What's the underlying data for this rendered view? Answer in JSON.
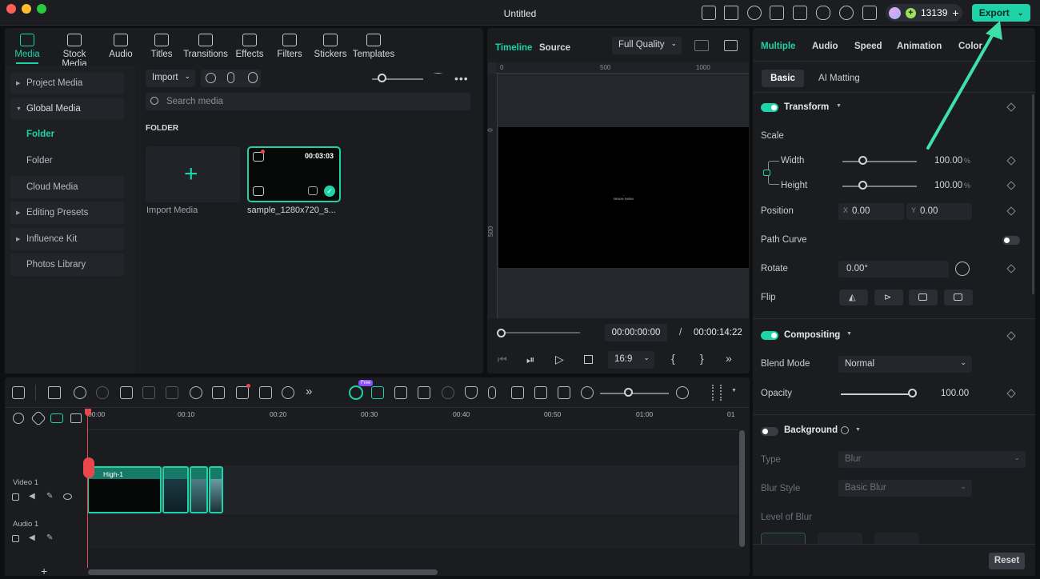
{
  "window": {
    "title": "Untitled"
  },
  "topbar": {
    "credits": "13139",
    "export_label": "Export"
  },
  "media_tabs": [
    {
      "label": "Media",
      "icon": "media-icon",
      "active": true
    },
    {
      "label": "Stock Media",
      "icon": "stock-media-icon"
    },
    {
      "label": "Audio",
      "icon": "audio-icon"
    },
    {
      "label": "Titles",
      "icon": "titles-icon"
    },
    {
      "label": "Transitions",
      "icon": "transitions-icon"
    },
    {
      "label": "Effects",
      "icon": "effects-icon"
    },
    {
      "label": "Filters",
      "icon": "filters-icon"
    },
    {
      "label": "Stickers",
      "icon": "stickers-icon"
    },
    {
      "label": "Templates",
      "icon": "templates-icon"
    }
  ],
  "sidebar": {
    "project_media": "Project Media",
    "global_media": "Global Media",
    "folder_active": "Folder",
    "folder": "Folder",
    "cloud_media": "Cloud Media",
    "editing_presets": "Editing Presets",
    "influence_kit": "Influence Kit",
    "photos_library": "Photos Library"
  },
  "media_panel": {
    "import_label": "Import",
    "search_placeholder": "Search media",
    "folder_heading": "FOLDER",
    "import_media_label": "Import Media",
    "clip_name": "sample_1280x720_s...",
    "clip_duration": "00:03:03"
  },
  "preview": {
    "tab_timeline": "Timeline",
    "tab_source": "Source",
    "quality": "Full Quality",
    "ruler": [
      "0",
      "500",
      "1000"
    ],
    "vruler": [
      "0",
      "500"
    ],
    "overlay_text_1": "...",
    "overlay_text_2": "BRAIN FARM",
    "current_time": "00:00:00:00",
    "separator": "/",
    "total_time": "00:00:14:22",
    "aspect": "16:9"
  },
  "props": {
    "tabs": [
      "Multiple",
      "Audio",
      "Speed",
      "Animation",
      "Color"
    ],
    "subtab_basic": "Basic",
    "subtab_ai": "AI Matting",
    "transform": "Transform",
    "scale": "Scale",
    "width": "Width",
    "width_val": "100.00",
    "height": "Height",
    "height_val": "100.00",
    "pct": "%",
    "position": "Position",
    "pos_x_label": "X",
    "pos_x": "0.00",
    "pos_y_label": "Y",
    "pos_y": "0.00",
    "path_curve": "Path Curve",
    "rotate": "Rotate",
    "rotate_val": "0.00°",
    "flip": "Flip",
    "compositing": "Compositing",
    "blend_mode": "Blend Mode",
    "blend_val": "Normal",
    "opacity": "Opacity",
    "opacity_val": "100.00",
    "background": "Background",
    "type": "Type",
    "type_val": "Blur",
    "blur_style": "Blur Style",
    "blur_style_val": "Basic Blur",
    "level_of_blur": "Level of Blur",
    "reset": "Reset"
  },
  "timeline": {
    "free_badge": "Free",
    "ticks": [
      "00:00",
      "00:10",
      "00:20",
      "00:30",
      "00:40",
      "00:50",
      "01:00",
      "01"
    ],
    "video_track": "Video 1",
    "audio_track": "Audio 1",
    "clip_label": "High-1",
    "add": "+"
  },
  "colors": {
    "accent": "#1ed3a8",
    "playhead": "#e8474c",
    "arrow": "#3ee0a8"
  }
}
